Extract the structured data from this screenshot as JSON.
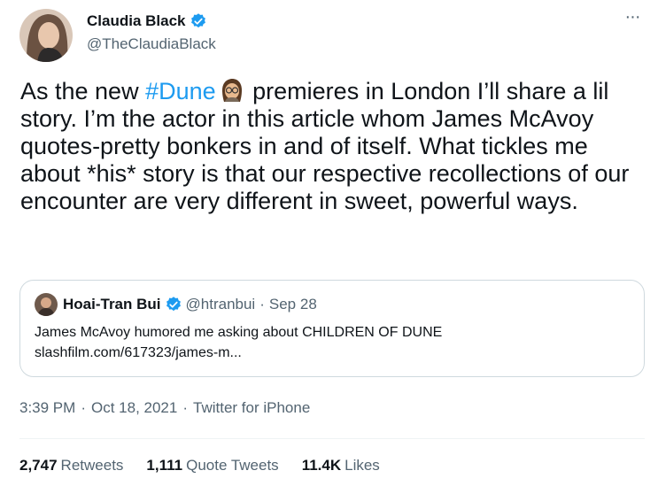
{
  "author": {
    "display_name": "Claudia Black",
    "handle": "@TheClaudiaBlack",
    "verified": true
  },
  "tweet": {
    "text_before": "As the new ",
    "hashtag": "#Dune",
    "emoji_icon": "dune-character-emoji",
    "text_after": " premieres in London I’ll share a lil story. I’m the actor in this article whom James McAvoy quotes-pretty bonkers in and of itself. What tickles me about *his* story is that our respective recollections of our encounter are very different in sweet, powerful ways."
  },
  "quoted_tweet": {
    "display_name": "Hoai-Tran Bui",
    "handle": "@htranbui",
    "separator": "·",
    "date": "Sep 28",
    "text": "James McAvoy humored me asking about CHILDREN OF DUNE",
    "link": "slashfilm.com/617323/james-m..."
  },
  "meta": {
    "time": "3:39 PM",
    "date": "Oct 18, 2021",
    "separator": "·",
    "source": "Twitter for iPhone"
  },
  "stats": {
    "retweets_count": "2,747",
    "retweets_label": "Retweets",
    "quotes_count": "1,111",
    "quotes_label": "Quote Tweets",
    "likes_count": "11.4K",
    "likes_label": "Likes"
  },
  "more_icon_glyph": "···",
  "colors": {
    "accent": "#1d9bf0",
    "text": "#0f1419",
    "secondary": "#536471",
    "border": "#cfd9de"
  }
}
